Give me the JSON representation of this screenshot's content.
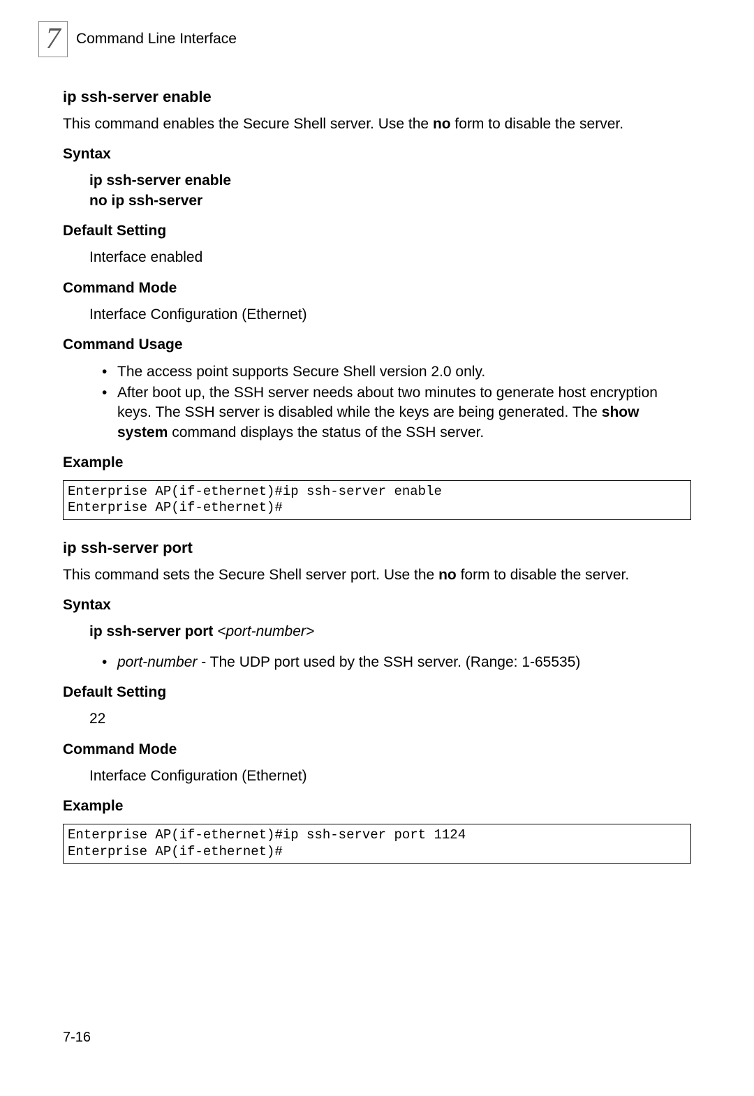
{
  "chapter": {
    "number": "7",
    "title": "Command Line Interface"
  },
  "cmd1": {
    "title": "ip ssh-server enable",
    "desc_pre": "This command enables the Secure Shell server. Use the ",
    "desc_bold": "no",
    "desc_post": " form to disable the server.",
    "syntax_label": "Syntax",
    "syntax_line1": "ip ssh-server enable",
    "syntax_line2": "no ip ssh-server",
    "default_label": "Default Setting",
    "default_value": "Interface enabled",
    "mode_label": "Command Mode",
    "mode_value": "Interface Configuration (Ethernet)",
    "usage_label": "Command Usage",
    "usage_item1": "The access point supports Secure Shell version 2.0 only.",
    "usage_item2_pre": "After boot up, the SSH server needs about two minutes to generate host encryption keys. The SSH server is disabled while the keys are being generated. The ",
    "usage_item2_bold": "show system",
    "usage_item2_post": " command displays the status of the SSH server.",
    "example_label": "Example",
    "example_code": "Enterprise AP(if-ethernet)#ip ssh-server enable\nEnterprise AP(if-ethernet)#"
  },
  "cmd2": {
    "title": "ip ssh-server port",
    "desc_pre": "This command sets the Secure Shell server port. Use the ",
    "desc_bold": "no",
    "desc_post": " form to disable the server.",
    "syntax_label": "Syntax",
    "syntax_bold": "ip ssh-server port ",
    "syntax_italic": "<port-number>",
    "param_italic": "port-number",
    "param_desc": " - The UDP port used by the SSH server. (Range: 1-65535)",
    "default_label": "Default Setting",
    "default_value": "22",
    "mode_label": "Command Mode",
    "mode_value": "Interface Configuration (Ethernet)",
    "example_label": "Example",
    "example_code": "Enterprise AP(if-ethernet)#ip ssh-server port 1124\nEnterprise AP(if-ethernet)#"
  },
  "footer": {
    "page": "7-16"
  }
}
